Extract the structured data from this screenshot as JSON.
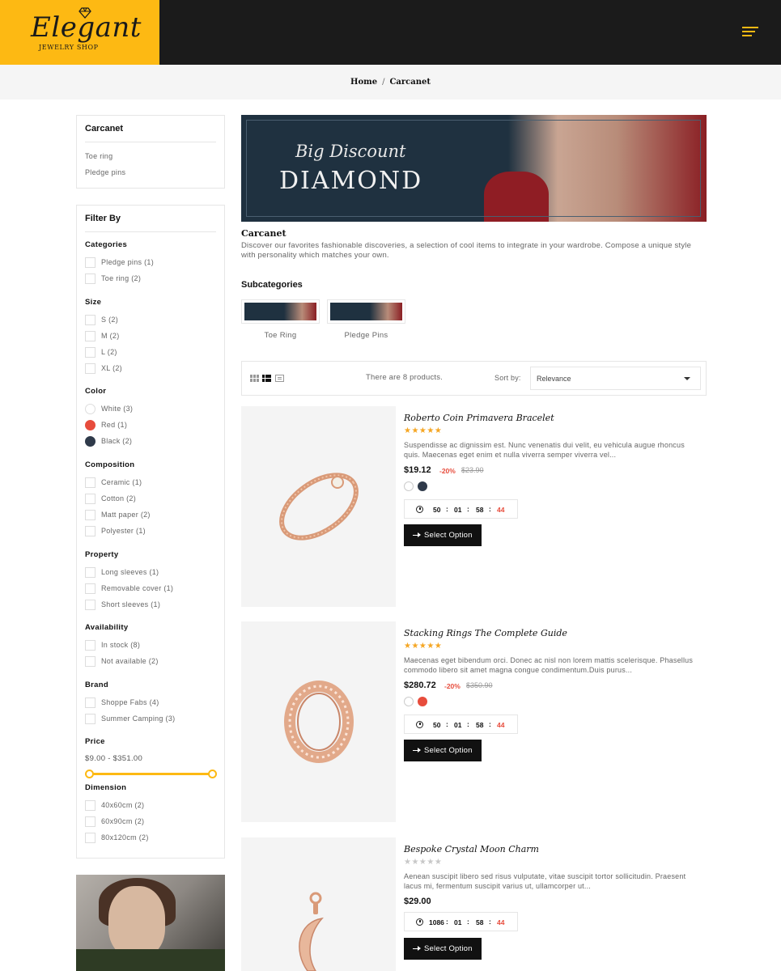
{
  "header": {
    "logo_text": "Elegant",
    "logo_subtext": "JEWELRY SHOP",
    "accent_color": "#fdb913"
  },
  "breadcrumb": {
    "home": "Home",
    "separator": "/",
    "current": "Carcanet"
  },
  "sidebar": {
    "category_box": {
      "title": "Carcanet",
      "links": [
        "Toe ring",
        "Pledge pins"
      ]
    },
    "filter": {
      "title": "Filter By",
      "categories": {
        "title": "Categories",
        "items": [
          "Pledge pins (1)",
          "Toe ring (2)"
        ]
      },
      "size": {
        "title": "Size",
        "items": [
          "S (2)",
          "M (2)",
          "L (2)",
          "XL (2)"
        ]
      },
      "color": {
        "title": "Color",
        "items": [
          {
            "label": "White (3)",
            "swatch": "#ffffff"
          },
          {
            "label": "Red (1)",
            "swatch": "#e74c3c"
          },
          {
            "label": "Black (2)",
            "swatch": "#2f3a4a"
          }
        ]
      },
      "composition": {
        "title": "Composition",
        "items": [
          "Ceramic (1)",
          "Cotton (2)",
          "Matt paper (2)",
          "Polyester (1)"
        ]
      },
      "property": {
        "title": "Property",
        "items": [
          "Long sleeves (1)",
          "Removable cover (1)",
          "Short sleeves (1)"
        ]
      },
      "availability": {
        "title": "Availability",
        "items": [
          "In stock (8)",
          "Not available (2)"
        ]
      },
      "brand": {
        "title": "Brand",
        "items": [
          "Shoppe Fabs (4)",
          "Summer Camping (3)"
        ]
      },
      "price": {
        "title": "Price",
        "range": "$9.00 - $351.00"
      },
      "dimension": {
        "title": "Dimension",
        "items": [
          "40x60cm (2)",
          "60x90cm (2)",
          "80x120cm (2)"
        ]
      }
    }
  },
  "banner": {
    "line1": "Big Discount",
    "line2": "DIAMOND"
  },
  "category": {
    "name": "Carcanet",
    "description": "Discover our favorites fashionable discoveries, a selection of cool items to integrate in your wardrobe. Compose a unique style with personality which matches your own."
  },
  "subcategories": {
    "title": "Subcategories",
    "items": [
      "Toe Ring",
      "Pledge Pins"
    ]
  },
  "toolbar": {
    "product_count": "There are 8 products.",
    "sort_label": "Sort by:",
    "sort_value": "Relevance"
  },
  "products": [
    {
      "name": "Roberto Coin Primavera Bracelet",
      "stars": "★★★★★",
      "rating": 5,
      "description": "Suspendisse ac dignissim est. Nunc venenatis dui velit, eu vehicula augue rhoncus quis. Maecenas eget enim et nulla viverra semper viverra vel...",
      "price": "$19.12",
      "discount": "-20%",
      "old_price": "$23.90",
      "colors": [
        "#ffffff",
        "#2f3a4a"
      ],
      "timer": {
        "d": "50",
        "h": "01",
        "m": "58",
        "s": "44",
        "sep": ":"
      },
      "button": "Select Option"
    },
    {
      "name": "Stacking Rings The Complete Guide",
      "stars": "★★★★★",
      "rating": 5,
      "description": "Maecenas eget bibendum orci. Donec ac nisl non lorem mattis scelerisque. Phasellus commodo libero sit amet magna congue condimentum.Duis purus...",
      "price": "$280.72",
      "discount": "-20%",
      "old_price": "$350.90",
      "colors": [
        "#ffffff",
        "#e74c3c"
      ],
      "timer": {
        "d": "50",
        "h": "01",
        "m": "58",
        "s": "44",
        "sep": ":"
      },
      "button": "Select Option"
    },
    {
      "name": "Bespoke Crystal Moon Charm",
      "stars": "★★★★★",
      "rating": 0,
      "description": "Aenean suscipit libero sed risus vulputate, vitae suscipit tortor sollicitudin. Praesent lacus mi, fermentum suscipit varius ut, ullamcorper ut...",
      "price": "$29.00",
      "discount": "",
      "old_price": "",
      "colors": [],
      "timer": {
        "d": "1086",
        "h": "01",
        "m": "58",
        "s": "44",
        "sep": ":"
      },
      "button": "Select Option"
    }
  ]
}
